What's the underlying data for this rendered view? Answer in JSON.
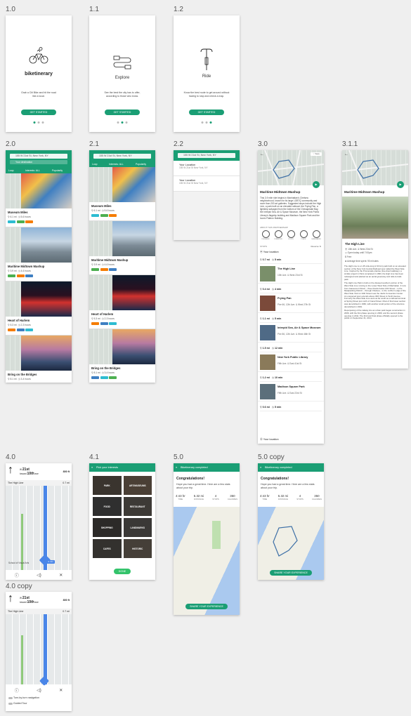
{
  "labels": {
    "s10": "1.0",
    "s11": "1.1",
    "s12": "1.2",
    "s20": "2.0",
    "s21": "2.1",
    "s22": "2.2",
    "s30": "3.0",
    "s311": "3.1.1",
    "s40": "4.0",
    "s41": "4.1",
    "s50": "5.0",
    "s50c": "5.0 copy",
    "s40c": "4.0 copy"
  },
  "onboarding": {
    "app_name": "biketinerary",
    "intro_text": "Grab a Citi Bike and hit the road like a local.",
    "explore_title": "Explore",
    "explore_text": "See the best the city has to offer, according to those who know.",
    "ride_title": "Ride",
    "ride_text": "Know the best route to get around without having to stop and check a map.",
    "cta": "GET STARTED"
  },
  "search": {
    "location": "155 W 21st St, New York, NY",
    "destination": "Your destination",
    "loop": "Loop",
    "interests": "Interests: ALL",
    "sort": "Popularity",
    "your_location": "Your Location",
    "your_location_addr": "155 W 21st St New York, NY",
    "your_location2": "Your Location",
    "your_location2_addr": "155 W 21st St New York, NY"
  },
  "routes20": [
    {
      "title": "Museum Miles",
      "dist": "6.1 mi",
      "time": "5-6 hours"
    },
    {
      "title": "Maritime Midtown Mashup",
      "dist": "3.9 mi",
      "time": "4-6 hours"
    },
    {
      "title": "Heart of Harlem",
      "dist": "5.3 mi",
      "time": "2-3 hours"
    },
    {
      "title": "Bring on the Bridges",
      "dist": "8.1 mi",
      "time": "3-4 hours"
    }
  ],
  "routes21": [
    {
      "title": "Museum Miles",
      "dist": "6.1 mi",
      "time": "5-6 hours"
    },
    {
      "title": "Maritime Midtown Mashup",
      "dist": "3.9 mi",
      "time": "4-6 hours"
    },
    {
      "title": "Heart of Harlem",
      "dist": "5.3 mi",
      "time": "2-3 hours"
    },
    {
      "title": "Bring on the Bridges",
      "dist": "8.1 mi",
      "time": "3-4 hours"
    }
  ],
  "detail": {
    "title": "Maritime Midtown Mashup",
    "desc": "This 3.9 mile ride begins in Manhattan's Chelsea neighborhood, known for its large LGBTQ community and more than 200 art galleries. Suggested stops include the High Line, a park built on an elevated railroad, the Frying Pan, a lightship salvaged from the bottom of the Chesapeake Bay, the Intrepid Sea, Air & Space Museum, the New York Public Library's flagship building and Madison Square Park and the Iconic Flatiron Building.",
    "about": "ABOUT THIS PARTNERSHIP",
    "icons": [
      "DISTANCE",
      "DURATION",
      "STOPS",
      "PLACE",
      "LANDMARKS"
    ],
    "stops_label": "STOPS",
    "reverse": "Reverse",
    "start": "Your location",
    "legs": [
      {
        "dist": "0.7 mi",
        "time": "5 min"
      },
      {
        "dist": "0.4 mi",
        "time": "4 min"
      },
      {
        "dist": "1.1 mi",
        "time": "5 min"
      },
      {
        "dist": "1.5 mi",
        "time": "12 min"
      },
      {
        "dist": "1.2 mi",
        "time": "10 min"
      },
      {
        "dist": "0.6 mi",
        "time": "5 min"
      }
    ],
    "stops": [
      {
        "name": "The High Line",
        "addr": "10th Ave. & West 23rd St"
      },
      {
        "name": "Frying Pan",
        "addr": "Pier 66, 12th Ave. & West 27th St"
      },
      {
        "name": "Intrepid Sea, Air & Space Museum",
        "addr": "Pier 86, 12th Ave. & West 46th St"
      },
      {
        "name": "New York Public Library",
        "addr": "Fifth Ave. & East 41st St"
      },
      {
        "name": "Madison Square Park",
        "addr": "Fifth Ave. & East 23rd St"
      }
    ],
    "end": "Your location"
  },
  "highline": {
    "title": "Maritime Midtown Mashup",
    "name": "The High Line",
    "addr": "10th Ave. & West 23rd St",
    "hours": "Open today until 7:00pm",
    "price": "Free",
    "spend": "Average time spent: 90 minutes",
    "p1": "The High Line is a 1.45-mile-long (2.33 km) park built on an elevated section of the New York Central Railroad spur called the West Side Line. Inspired by the Promenade plantée (tree-lined walkway), a similar project in Paris completed in 1993, the High Line has been redesigned and planted as an aerial greenway and rails-to-trails park.",
    "p2": "The High Line Park is built on the disused southern portion of the West Side Line running to the Lower West Side of Manhattan. It runs from Gansevoort Street – three blocks below 14th Street – in the Meatpacking District – through Chelsea – to the northern edge of the West Side Yard on 34th Street near the Javits Convention Center. An unopened spur extends above 30th Street to Tenth Avenue. Formerly the West Side Line went as far south as a railroad terminal at Spring Street just north of Canal Street. Most of that lower section was demolished in 1960, with another small portion of the structure demolished in 1991.",
    "p3": "Repurposing of the railway into an urban park began construction in 2006, with the first phase opening in 2009, and the second phase opening in 2011. The third and final phase officially opened to the public on September 21, 2014."
  },
  "nav": {
    "street_pre": "W",
    "street": "21st",
    "toward": "toward",
    "cross": "10th",
    "cross_suf": "ave",
    "dist": "800 ft",
    "next": "The High Line",
    "next_dist": "0.7 mi",
    "school": "School of Visual Arts",
    "eta": "2 min",
    "ta_label": "Turn-by-turn navigation",
    "gt_label": "Guided Tour"
  },
  "interests": {
    "title": "Pick your interests",
    "items": [
      "PARK",
      "ART/MUSEUMS",
      "FOOD",
      "RESTAURANT",
      "SHOPPING",
      "LANDMARKS",
      "CAFES",
      "HISTORIC"
    ],
    "done": "DONE"
  },
  "complete": {
    "header": "Biketinerary completed",
    "congrats": "Congratulations!",
    "msg": "Hope you had a great time. Here are a few stats about your trip.",
    "stats": [
      {
        "v": "4:43 hr",
        "l": "TIME"
      },
      {
        "v": "5.32 mi",
        "l": "DISTANCE"
      },
      {
        "v": "4",
        "l": "STOPS"
      },
      {
        "v": "350",
        "l": "CALORIES"
      }
    ],
    "share": "SHARE YOUR EXPERIENCE"
  }
}
